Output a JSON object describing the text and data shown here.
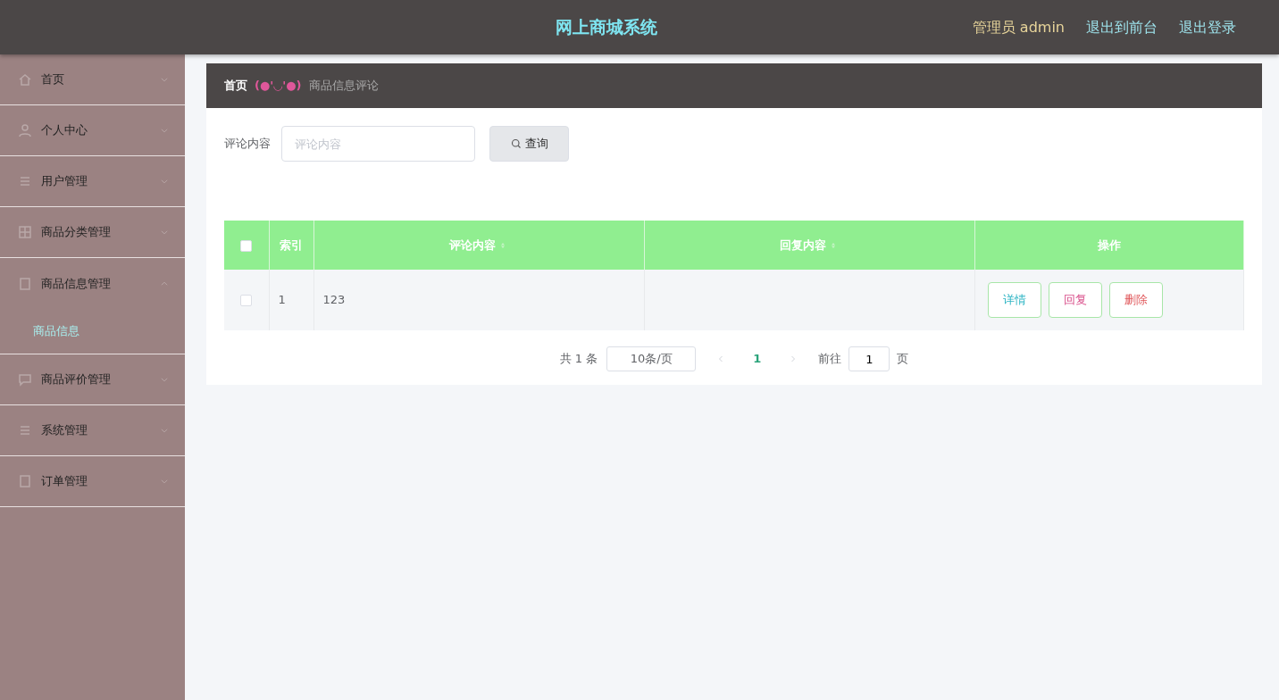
{
  "header": {
    "title": "网上商城系统",
    "user": "管理员 admin",
    "links": [
      "退出到前台",
      "退出登录"
    ]
  },
  "sidebar": {
    "items": [
      {
        "label": "首页",
        "kind": "home",
        "expanded": false
      },
      {
        "label": "个人中心",
        "kind": "person",
        "expanded": false
      },
      {
        "label": "用户管理",
        "kind": "list",
        "expanded": false
      },
      {
        "label": "商品分类管理",
        "kind": "grid",
        "expanded": false
      },
      {
        "label": "商品信息管理",
        "kind": "doc",
        "expanded": true,
        "children": [
          {
            "label": "商品信息",
            "selected": true
          }
        ]
      },
      {
        "label": "商品评价管理",
        "kind": "chat",
        "expanded": false
      },
      {
        "label": "系统管理",
        "kind": "list",
        "expanded": false
      },
      {
        "label": "订单管理",
        "kind": "doc",
        "expanded": false
      }
    ]
  },
  "breadcrumb": {
    "home": "首页",
    "emoticon": "(●'◡'●)",
    "current": "商品信息评论"
  },
  "search": {
    "label": "评论内容",
    "placeholder": "评论内容",
    "button": "查询"
  },
  "table": {
    "columns": [
      {
        "label": "索引",
        "sortable": false
      },
      {
        "label": "评论内容",
        "sortable": true
      },
      {
        "label": "回复内容",
        "sortable": true
      },
      {
        "label": "操作",
        "sortable": false
      }
    ],
    "all_checked": false,
    "rows": [
      {
        "checked": false,
        "index": "1",
        "comment": "123",
        "actions": [
          {
            "label": "详情",
            "color": "#2fb5c4"
          },
          {
            "label": "回复",
            "color": "#d9508b"
          },
          {
            "label": "删除",
            "color": "#e0575a"
          }
        ]
      }
    ]
  },
  "pagination": {
    "total": "共 1 条",
    "page_size": "10条/页",
    "pages": [
      {
        "label": "1",
        "selected": true
      }
    ],
    "goto_label": "前往",
    "goto_value": "1",
    "goto_suffix": "页"
  }
}
